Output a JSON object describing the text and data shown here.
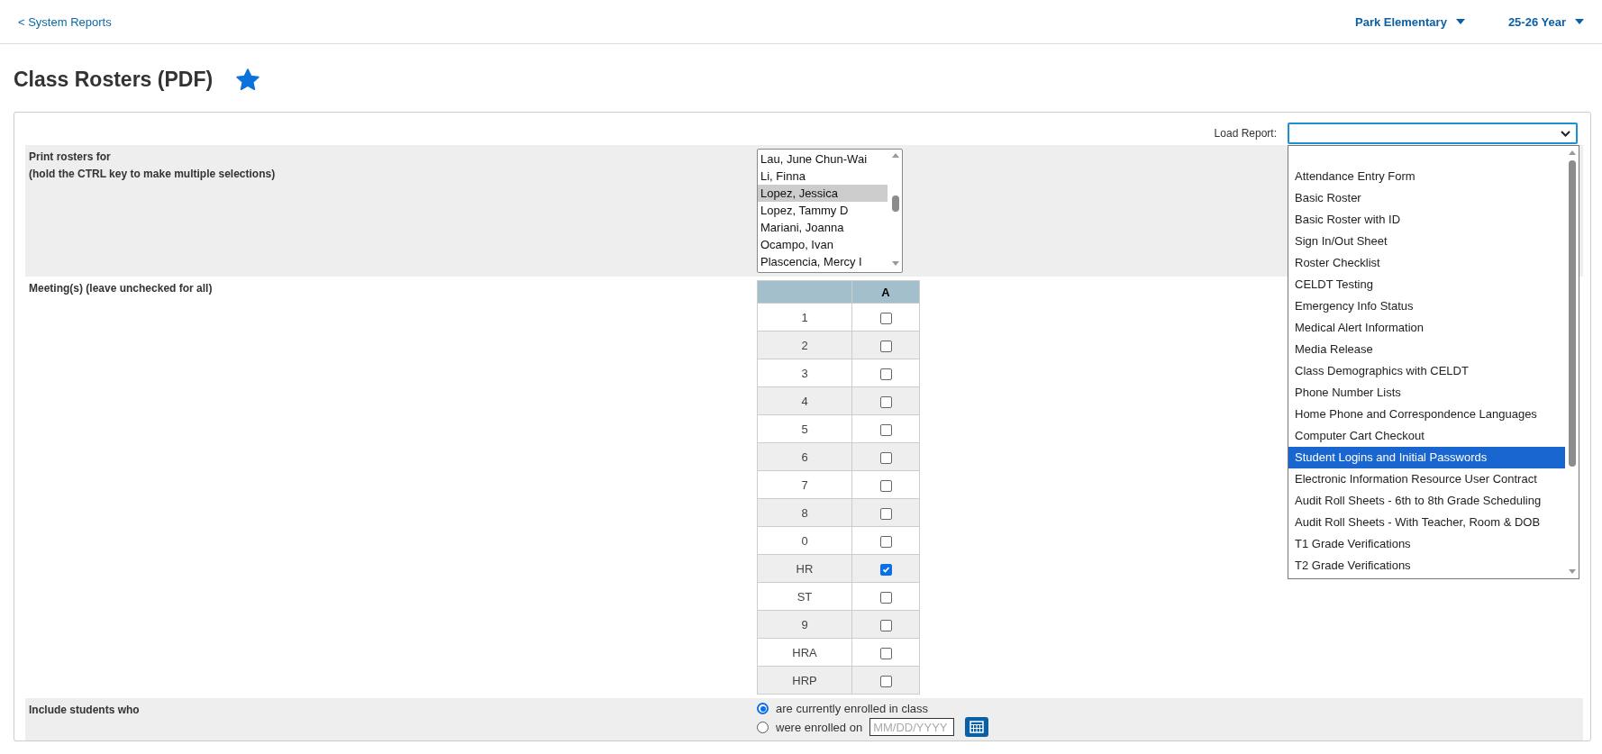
{
  "top_bar": {
    "back_link": "< System Reports",
    "school": "Park Elementary",
    "year": "25-26 Year"
  },
  "page_title": "Class Rosters (PDF)",
  "favorite": true,
  "load_report": {
    "label": "Load Report:",
    "open": true,
    "options": [
      {
        "label": "Attendance Entry Form",
        "selected": false
      },
      {
        "label": "Basic Roster",
        "selected": false
      },
      {
        "label": "Basic Roster with ID",
        "selected": false
      },
      {
        "label": "Sign In/Out Sheet",
        "selected": false
      },
      {
        "label": "Roster Checklist",
        "selected": false
      },
      {
        "label": "CELDT Testing",
        "selected": false
      },
      {
        "label": "Emergency Info Status",
        "selected": false
      },
      {
        "label": "Medical Alert Information",
        "selected": false
      },
      {
        "label": "Media Release",
        "selected": false
      },
      {
        "label": "Class Demographics with CELDT",
        "selected": false
      },
      {
        "label": "Phone Number Lists",
        "selected": false
      },
      {
        "label": "Home Phone and Correspondence Languages",
        "selected": false
      },
      {
        "label": "Computer Cart Checkout",
        "selected": false
      },
      {
        "label": "Student Logins and Initial Passwords",
        "selected": true
      },
      {
        "label": "Electronic Information Resource User Contract",
        "selected": false
      },
      {
        "label": "Audit Roll Sheets - 6th to 8th Grade Scheduling",
        "selected": false
      },
      {
        "label": "Audit Roll Sheets - With Teacher, Room & DOB",
        "selected": false
      },
      {
        "label": "T1 Grade Verifications",
        "selected": false
      },
      {
        "label": "T2 Grade Verifications",
        "selected": false
      }
    ]
  },
  "print_rosters": {
    "label": "Print rosters for",
    "hint": "(hold the CTRL key to make multiple selections)",
    "teachers": [
      {
        "name": "Lau, June Chun-Wai",
        "selected": false
      },
      {
        "name": "Li, Finna",
        "selected": false
      },
      {
        "name": "Lopez, Jessica",
        "selected": true
      },
      {
        "name": "Lopez, Tammy D",
        "selected": false
      },
      {
        "name": "Mariani, Joanna",
        "selected": false
      },
      {
        "name": "Ocampo, Ivan",
        "selected": false
      },
      {
        "name": "Plascencia, Mercy I",
        "selected": false
      }
    ]
  },
  "meetings": {
    "label": "Meeting(s) (leave unchecked for all)",
    "column": "A",
    "rows": [
      {
        "period": "1",
        "checked": false
      },
      {
        "period": "2",
        "checked": false
      },
      {
        "period": "3",
        "checked": false
      },
      {
        "period": "4",
        "checked": false
      },
      {
        "period": "5",
        "checked": false
      },
      {
        "period": "6",
        "checked": false
      },
      {
        "period": "7",
        "checked": false
      },
      {
        "period": "8",
        "checked": false
      },
      {
        "period": "0",
        "checked": false
      },
      {
        "period": "HR",
        "checked": true
      },
      {
        "period": "ST",
        "checked": false
      },
      {
        "period": "9",
        "checked": false
      },
      {
        "period": "HRA",
        "checked": false
      },
      {
        "period": "HRP",
        "checked": false
      }
    ]
  },
  "include": {
    "label": "Include students who",
    "options": [
      {
        "kind": "plain",
        "label": "are currently enrolled in class",
        "selected": true
      },
      {
        "kind": "date",
        "label": "were enrolled on",
        "selected": false,
        "placeholder": "MM/DD/YYYY"
      }
    ]
  }
}
